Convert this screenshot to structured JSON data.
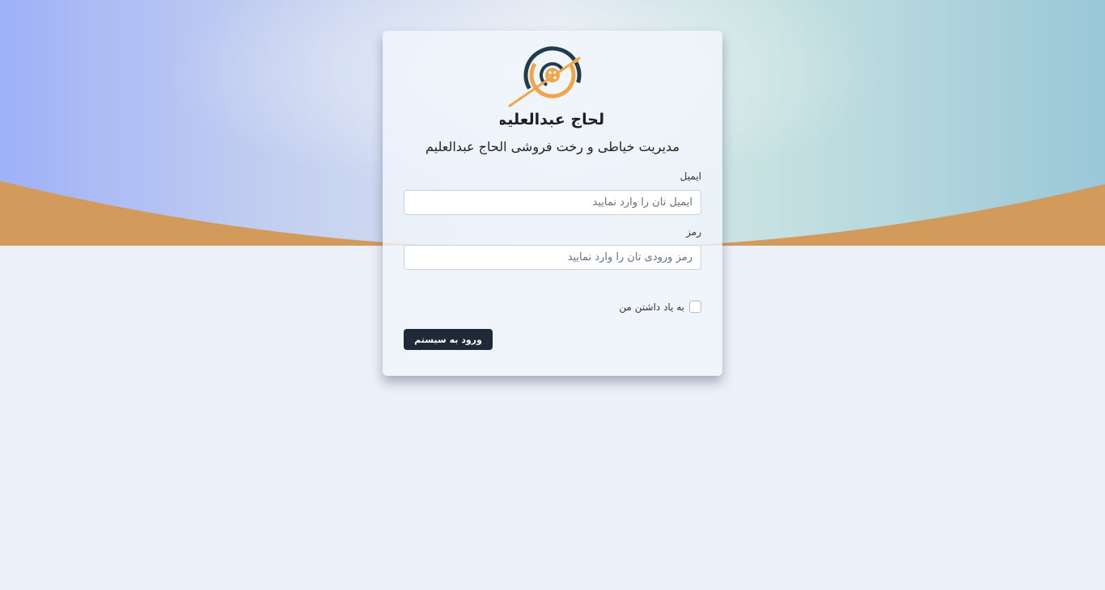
{
  "brand": {
    "logo_icon": "sewing-needle-button-icon",
    "logo_text": "الحاج عبدالعلیم",
    "colors": {
      "accent": "#f0a54a",
      "dark": "#1f3d4d"
    }
  },
  "subtitle": "مدیریت خیاطی و رخت فروشی الحاج عبدالعلیم",
  "form": {
    "email_label": "ایمیل",
    "email_placeholder": "ایمیل تان را وارد نمایید",
    "email_value": "",
    "password_label": "رمز",
    "password_placeholder": "رمز ورودی تان را وارد نمایید",
    "password_value": "",
    "remember_label": "به یاد داشتن من",
    "remember_checked": false,
    "submit_label": "ورود به سیستم"
  },
  "colors": {
    "button_bg": "#1f2937",
    "page_bg": "#ecf0f9",
    "wave": "#d29b5c"
  }
}
